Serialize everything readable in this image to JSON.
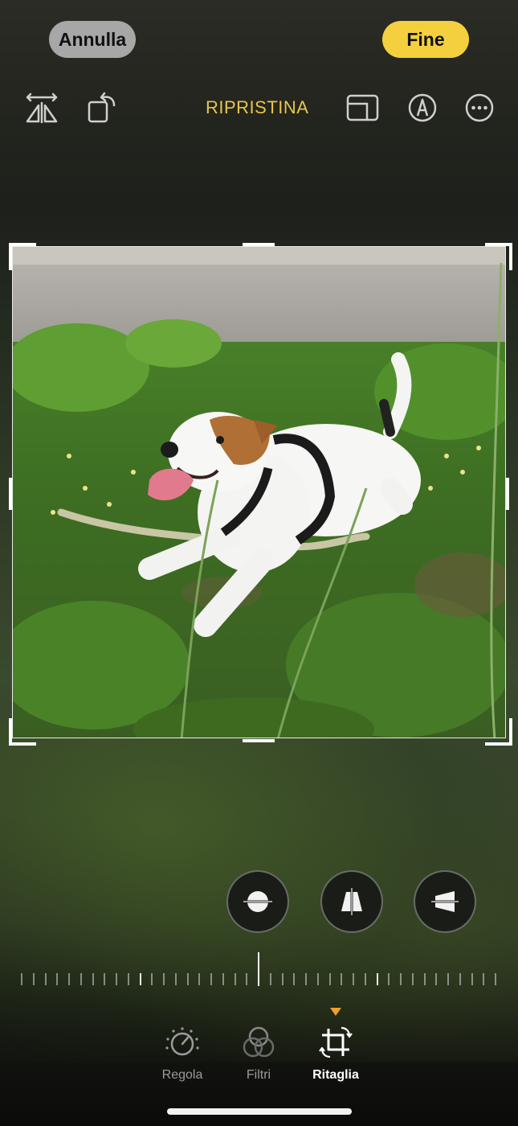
{
  "header": {
    "cancel_label": "Annulla",
    "done_label": "Fine",
    "reset_label": "RIPRISTINA"
  },
  "toolbar": {
    "left_icons": [
      "flip-horizontal-icon",
      "rotate-icon"
    ],
    "right_icons": [
      "aspect-ratio-icon",
      "markup-pen-icon",
      "more-icon"
    ]
  },
  "photo": {
    "description_icon": "dog-photo"
  },
  "adjust_buttons": [
    "straighten-icon",
    "vertical-perspective-icon",
    "horizontal-perspective-icon"
  ],
  "tabs": [
    {
      "label": "Regola",
      "icon": "adjust-dial-icon",
      "active": false
    },
    {
      "label": "Filtri",
      "icon": "filters-icon",
      "active": false
    },
    {
      "label": "Ritaglia",
      "icon": "crop-icon",
      "active": true
    }
  ],
  "colors": {
    "accent_yellow": "#f4d03f",
    "reset_text": "#e7c64a",
    "active_marker": "#f0a02a"
  }
}
